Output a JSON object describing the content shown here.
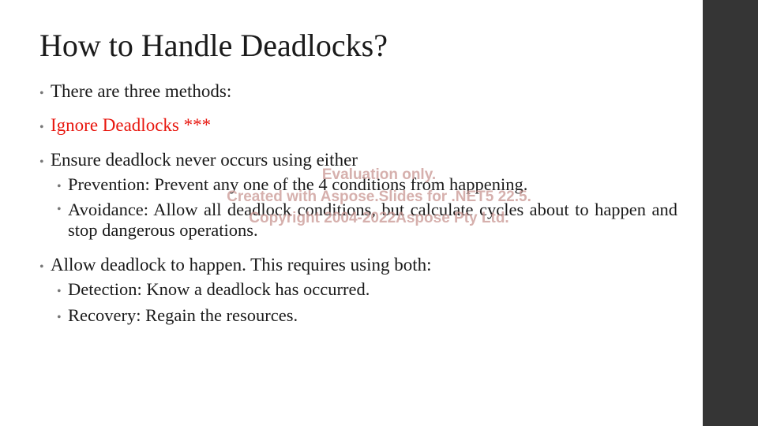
{
  "slide": {
    "title": "How to Handle Deadlocks?",
    "bullets": {
      "b1": "There are three methods:",
      "b2": "Ignore Deadlocks ***",
      "b3": "Ensure deadlock never occurs using either",
      "b3_1": "Prevention: Prevent any one of the 4 conditions from happening.",
      "b3_2": "Avoidance: Allow all deadlock conditions, but calculate cycles about to happen and stop dangerous operations.",
      "b4": "Allow deadlock to happen. This requires using both:",
      "b4_1": "Detection: Know a deadlock has occurred.",
      "b4_2": "Recovery: Regain the resources."
    },
    "bullet_glyph": "•",
    "accent_color": "#e8170f",
    "sidebar_color": "#353535"
  },
  "watermark": {
    "line1": "Evaluation only.",
    "line2": "Created with Aspose.Slides for .NET5 22.5.",
    "line3": "Copyright 2004-2022Aspose Pty Ltd."
  }
}
